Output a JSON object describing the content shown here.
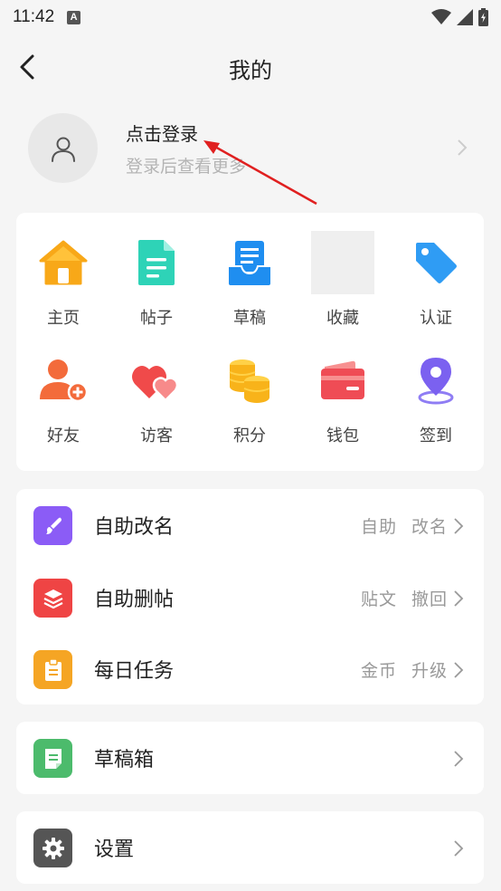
{
  "status_bar": {
    "time": "11:42",
    "notice_badge": "A"
  },
  "nav": {
    "title": "我的"
  },
  "profile": {
    "title": "点击登录",
    "subtitle": "登录后查看更多"
  },
  "grid": [
    {
      "label": "主页",
      "icon": "home-icon"
    },
    {
      "label": "帖子",
      "icon": "post-document-icon"
    },
    {
      "label": "草稿",
      "icon": "draft-tray-icon"
    },
    {
      "label": "收藏",
      "icon": "favorites-placeholder-icon"
    },
    {
      "label": "认证",
      "icon": "tag-icon"
    },
    {
      "label": "好友",
      "icon": "add-friend-icon"
    },
    {
      "label": "访客",
      "icon": "visitor-hearts-icon"
    },
    {
      "label": "积分",
      "icon": "coins-icon"
    },
    {
      "label": "钱包",
      "icon": "wallet-icon"
    },
    {
      "label": "签到",
      "icon": "location-pin-icon"
    }
  ],
  "tools": [
    {
      "title": "自助改名",
      "tags": [
        "自助",
        "改名"
      ],
      "icon": "brush-icon",
      "color": "#8b5cf6"
    },
    {
      "title": "自助删帖",
      "tags": [
        "贴文",
        "撤回"
      ],
      "icon": "layers-icon",
      "color": "#ef4444"
    },
    {
      "title": "每日任务",
      "tags": [
        "金币",
        "升级"
      ],
      "icon": "clipboard-icon",
      "color": "#f5a524"
    }
  ],
  "drafts_box": {
    "title": "草稿箱",
    "icon": "note-icon",
    "color": "#4cbb6c"
  },
  "settings": {
    "title": "设置",
    "icon": "gear-icon",
    "color": "#555555"
  }
}
